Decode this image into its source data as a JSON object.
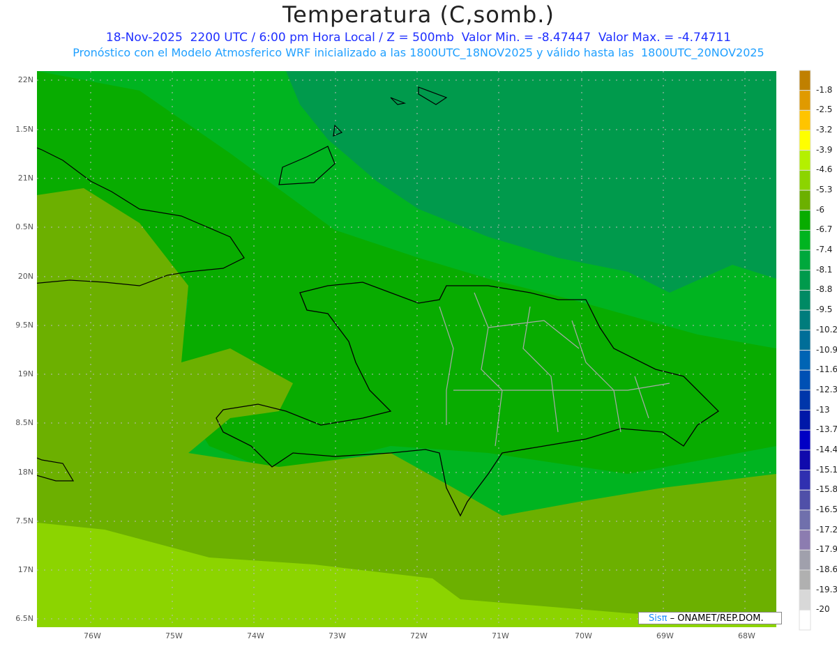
{
  "title": "Temperatura (C,somb.)",
  "line1": "18-Nov-2025  2200 UTC / 6:00 pm Hora Local / Z = 500mb  Valor Min. = -8.47447  Valor Max. = -4.74711",
  "line2": "Pronóstico con el Modelo Atmosferico WRF inicializado a las 1800UTC_18NOV2025 y válido hasta las  1800UTC_20NOV2025",
  "lon_labels": [
    "76W",
    "75W",
    "74W",
    "73W",
    "72W",
    "71W",
    "70W",
    "69W",
    "68W"
  ],
  "lat_labels": [
    "22N",
    "1.5N",
    "21N",
    "0.5N",
    "20N",
    "9.5N",
    "19N",
    "8.5N",
    "18N",
    "7.5N",
    "17N",
    "6.5N"
  ],
  "colorbar": {
    "labels": [
      "-1.8",
      "-2.5",
      "-3.2",
      "-3.9",
      "-4.6",
      "-5.3",
      "-6",
      "-6.7",
      "-7.4",
      "-8.1",
      "-8.8",
      "-9.5",
      "-10.2",
      "-10.9",
      "-11.6",
      "-12.3",
      "-13",
      "-13.7",
      "-14.4",
      "-15.1",
      "-15.8",
      "-16.5",
      "-17.2",
      "-17.9",
      "-18.6",
      "-19.3",
      "-20"
    ],
    "colors": [
      "#c08000",
      "#e09a00",
      "#ffc400",
      "#ffff00",
      "#b4f000",
      "#8cd400",
      "#6cb000",
      "#08ac00",
      "#00b420",
      "#00a83c",
      "#009a4c",
      "#008a64",
      "#007c7c",
      "#006e98",
      "#0064b4",
      "#0050b4",
      "#0036aa",
      "#0018a8",
      "#0000c4",
      "#100aac",
      "#3030b0",
      "#5050a8",
      "#7070ac",
      "#8c7cb0",
      "#a0a0ac",
      "#b0b0b0",
      "#d8d8d8",
      "#ffffff"
    ]
  },
  "credit": {
    "logo": "Sisπ",
    "text": " – ONAMET/REP.DOM."
  }
}
